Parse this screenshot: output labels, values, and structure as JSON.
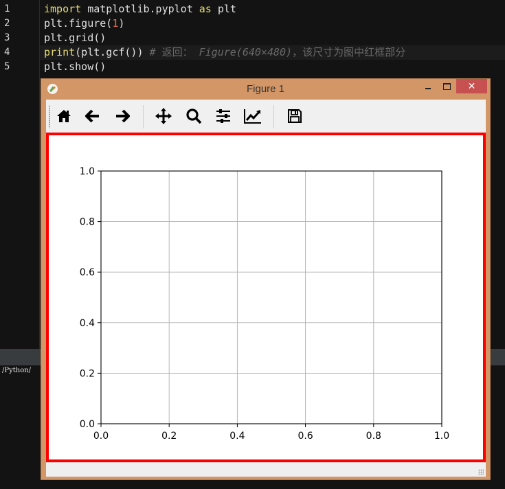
{
  "editor": {
    "line_numbers": [
      "1",
      "2",
      "3",
      "4",
      "5"
    ],
    "lines": [
      {
        "parts": [
          {
            "t": "import",
            "c": "kw"
          },
          {
            "t": " matplotlib.pyplot ",
            "c": ""
          },
          {
            "t": "as",
            "c": "kw"
          },
          {
            "t": " plt",
            "c": ""
          }
        ]
      },
      {
        "parts": [
          {
            "t": "plt.figure(",
            "c": ""
          },
          {
            "t": "1",
            "c": "num"
          },
          {
            "t": ")",
            "c": ""
          }
        ]
      },
      {
        "parts": [
          {
            "t": "plt.grid()",
            "c": ""
          }
        ]
      },
      {
        "parts": [
          {
            "t": "print",
            "c": "fn"
          },
          {
            "t": "(plt.gcf())",
            "c": ""
          },
          {
            "t": " # 返回： ",
            "c": "cm"
          },
          {
            "t": "Figure(640×480)",
            "c": "cm-i"
          },
          {
            "t": "，该尺寸为图中红框部分",
            "c": "cm"
          }
        ]
      },
      {
        "parts": [
          {
            "t": "plt.show()",
            "c": ""
          }
        ]
      }
    ]
  },
  "console": {
    "text": "/Python/"
  },
  "window": {
    "title": "Figure 1",
    "controls": {
      "minimize": "minimize",
      "maximize": "maximize",
      "close": "✕"
    },
    "toolbar": [
      {
        "name": "home-button",
        "icon": "home-icon",
        "tooltip": "Home"
      },
      {
        "name": "back-button",
        "icon": "arrow-left-icon",
        "tooltip": "Back"
      },
      {
        "name": "forward-button",
        "icon": "arrow-right-icon",
        "tooltip": "Forward"
      },
      {
        "name": "pan-button",
        "icon": "move-icon",
        "tooltip": "Pan"
      },
      {
        "name": "zoom-button",
        "icon": "magnifier-icon",
        "tooltip": "Zoom"
      },
      {
        "name": "subplots-button",
        "icon": "sliders-icon",
        "tooltip": "Configure subplots"
      },
      {
        "name": "edit-axis-button",
        "icon": "line-chart-icon",
        "tooltip": "Edit axis"
      },
      {
        "name": "save-button",
        "icon": "floppy-disk-icon",
        "tooltip": "Save"
      }
    ],
    "highlight_color": "#ff0000",
    "titlebar_color": "#d39667"
  },
  "chart_data": {
    "type": "line",
    "title": "",
    "xlabel": "",
    "ylabel": "",
    "xlim": [
      0.0,
      1.0
    ],
    "ylim": [
      0.0,
      1.0
    ],
    "xticks": [
      "0.0",
      "0.2",
      "0.4",
      "0.6",
      "0.8",
      "1.0"
    ],
    "yticks": [
      "0.0",
      "0.2",
      "0.4",
      "0.6",
      "0.8",
      "1.0"
    ],
    "grid": true,
    "series": []
  }
}
